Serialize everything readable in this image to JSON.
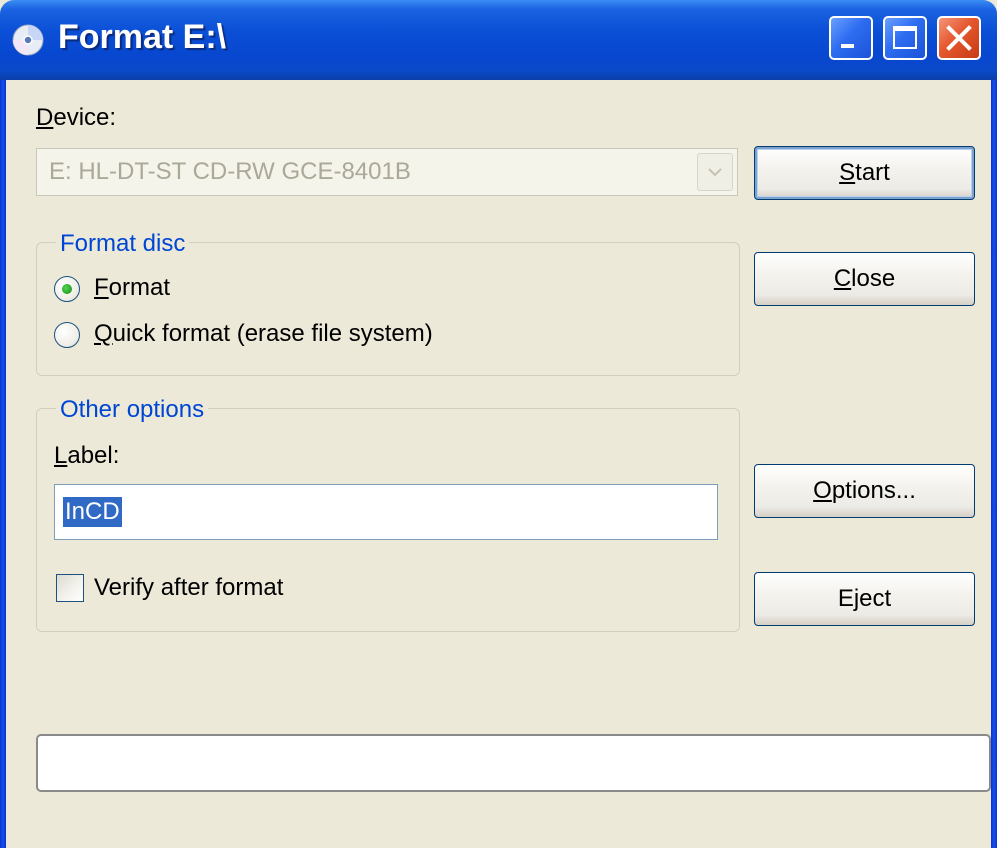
{
  "window": {
    "title": "Format E:\\",
    "icons": {
      "app": "disc-icon",
      "minimize": "minimize-icon",
      "maximize": "maximize-icon",
      "close": "close-icon"
    }
  },
  "device": {
    "label_prefix": "",
    "label_underlined": "D",
    "label_rest": "evice:",
    "selected": "E: HL-DT-ST CD-RW GCE-8401B",
    "enabled": false
  },
  "buttons": {
    "start": {
      "mn": "S",
      "rest": "tart"
    },
    "close": {
      "mn": "C",
      "rest": "lose"
    },
    "options": {
      "mn": "O",
      "rest": "ptions..."
    },
    "eject": {
      "pre": "E",
      "mn": "j",
      "rest": "ect"
    }
  },
  "format_disc": {
    "title": "Format disc",
    "options": [
      {
        "mn": "F",
        "rest": "ormat",
        "selected": true
      },
      {
        "mn": "Q",
        "rest": "uick format (erase file system)",
        "selected": false
      }
    ]
  },
  "other_options": {
    "title": "Other options",
    "label_caption": {
      "mn": "L",
      "rest": "abel:"
    },
    "label_value": "InCD",
    "verify": {
      "text": "Verify after format",
      "checked": false
    }
  },
  "progress": {
    "fraction": 0
  },
  "colors": {
    "titlebar": "#0a4fd6",
    "group_title": "#0046d5",
    "selection": "#316ac5",
    "radio_dot": "#21a121",
    "close_button": "#e5572e"
  }
}
